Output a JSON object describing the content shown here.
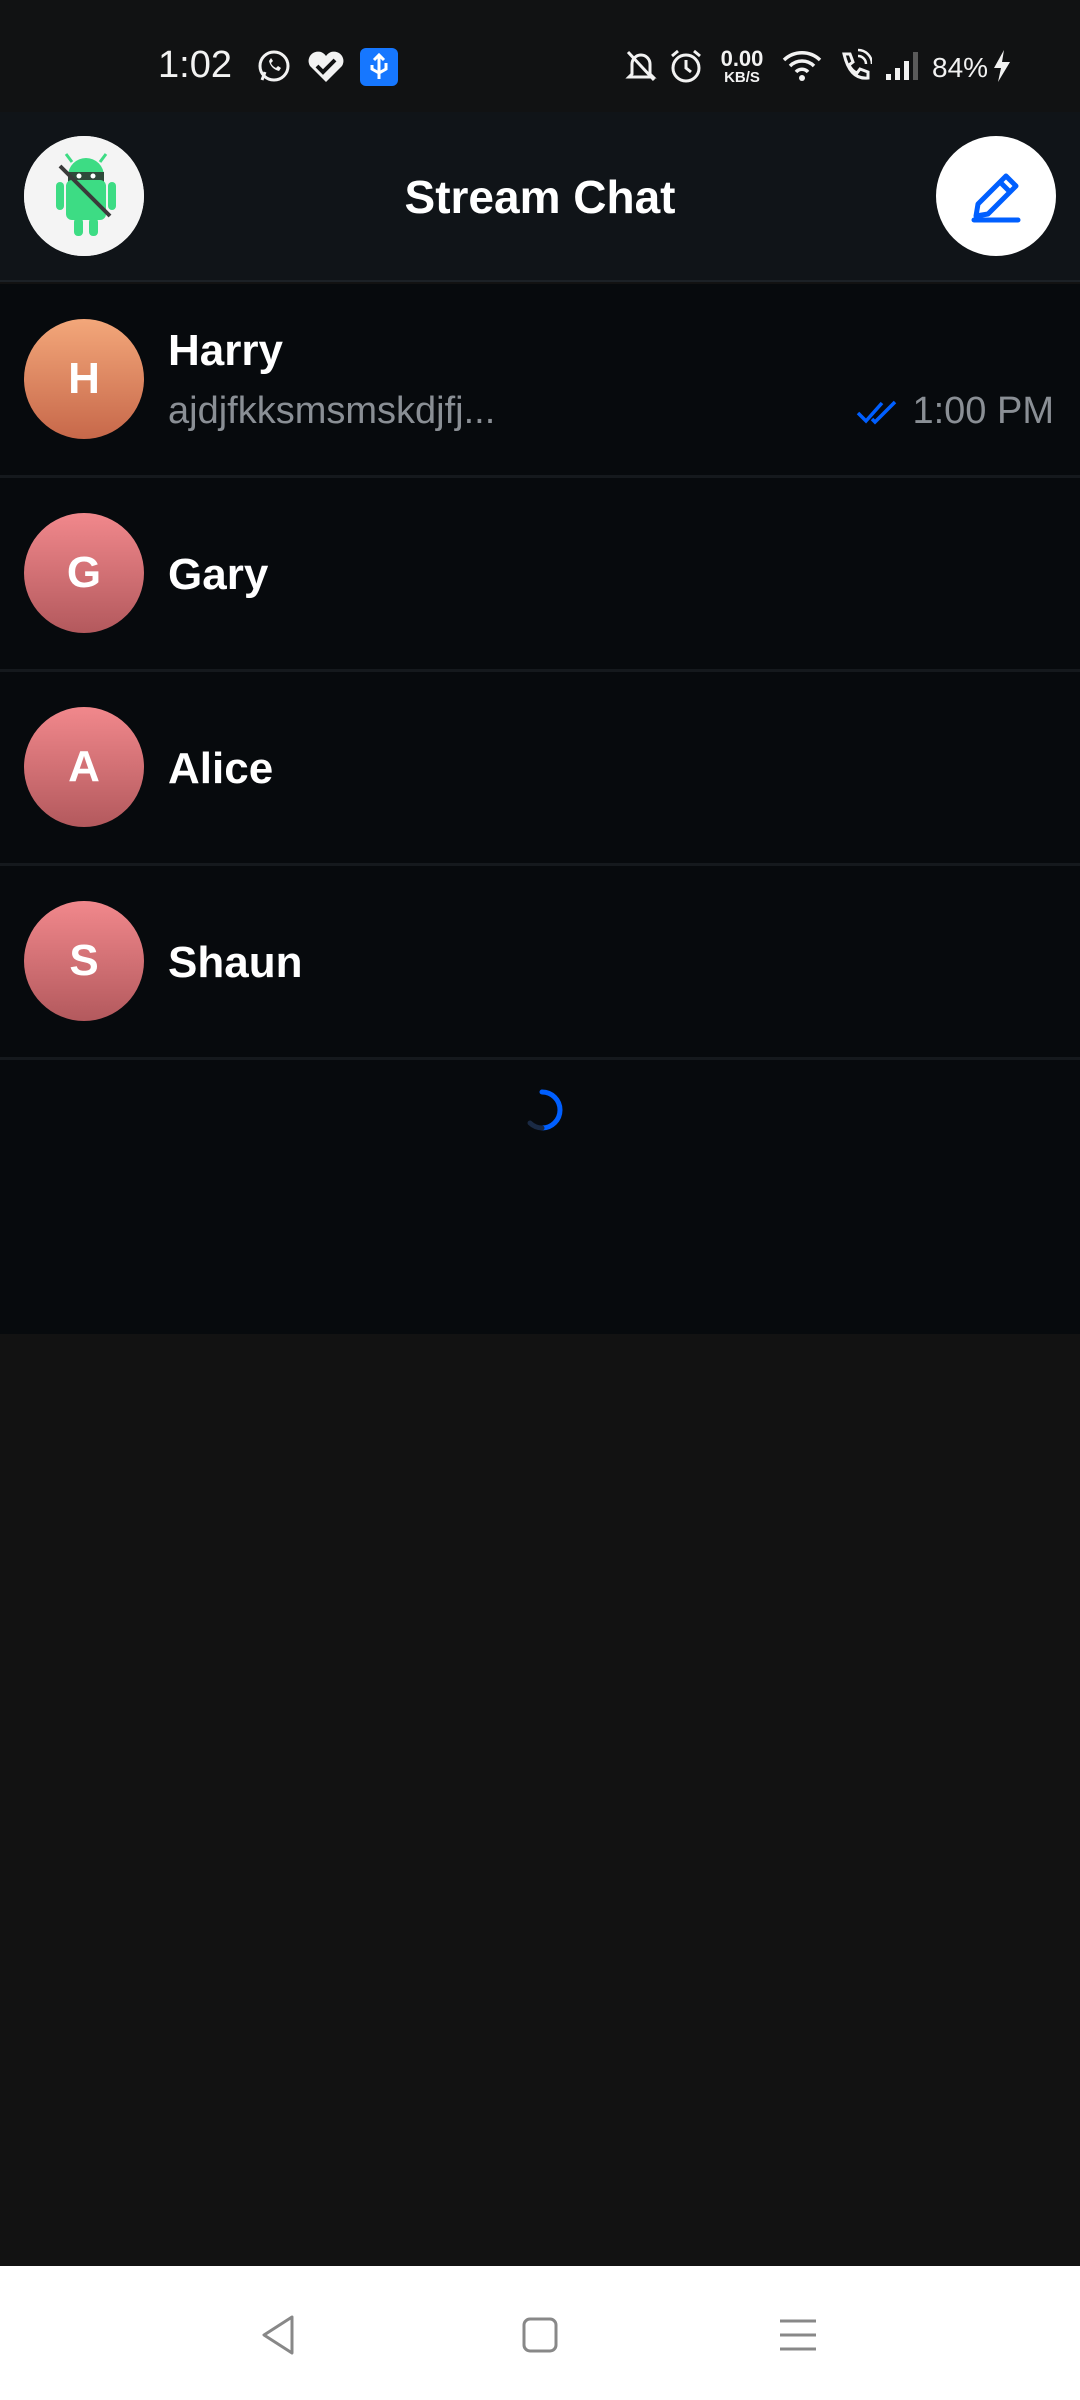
{
  "status_bar": {
    "time": "1:02",
    "network_speed_value": "0.00",
    "network_speed_unit": "KB/S",
    "battery": "84%",
    "icons": [
      "whatsapp-icon",
      "health-icon",
      "usb-icon",
      "mute-icon",
      "alarm-icon",
      "wifi-icon",
      "wifi-call-icon",
      "signal-icon",
      "charging-icon"
    ]
  },
  "header": {
    "title": "Stream Chat",
    "compose_icon": "pencil-icon",
    "accent_color": "#005fff"
  },
  "channels": [
    {
      "initial": "H",
      "name": "Harry",
      "preview": "ajdjfkksmsmskdjfj...",
      "time": "1:00 PM",
      "read_status": "double-check-icon"
    },
    {
      "initial": "G",
      "name": "Gary"
    },
    {
      "initial": "A",
      "name": "Alice"
    },
    {
      "initial": "S",
      "name": "Shaun"
    }
  ],
  "navbar": {
    "icons": [
      "back-icon",
      "home-icon",
      "recents-icon"
    ]
  }
}
